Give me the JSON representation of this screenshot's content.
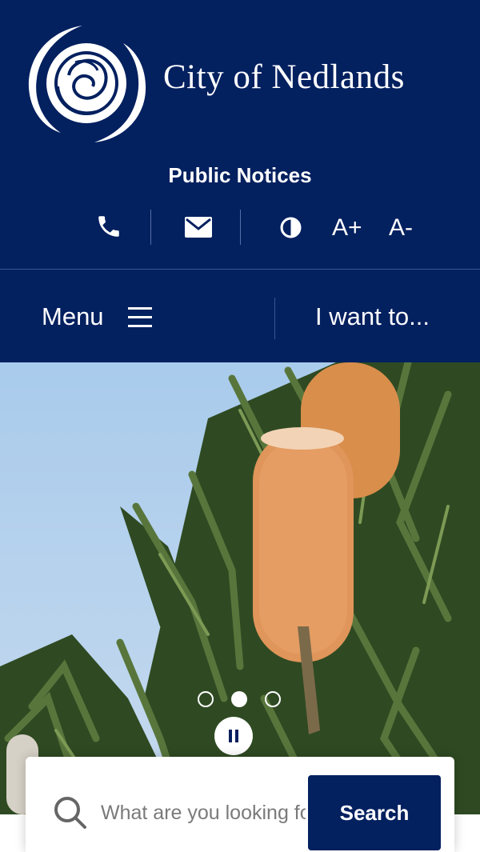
{
  "header": {
    "site_name": "City of Nedlands",
    "public_notices": "Public Notices",
    "toolbar": {
      "phone_icon": "phone-icon",
      "email_icon": "envelope-icon",
      "contrast_icon": "contrast-icon",
      "increase_font": "A+",
      "decrease_font": "A-"
    }
  },
  "nav": {
    "menu_label": "Menu",
    "menu_icon": "hamburger-icon",
    "i_want_to": "I want to..."
  },
  "hero": {
    "slides_count": 3,
    "active_slide": 2,
    "pause_icon": "pause-icon"
  },
  "search": {
    "placeholder": "What are you looking for?",
    "button_label": "Search",
    "icon": "search-icon"
  },
  "colors": {
    "brand_navy": "#03205f",
    "white": "#ffffff"
  }
}
